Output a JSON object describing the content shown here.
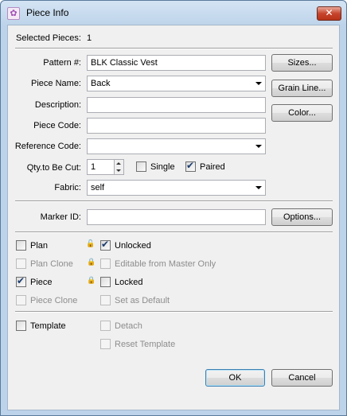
{
  "window": {
    "title": "Piece Info"
  },
  "selected": {
    "label": "Selected Pieces:",
    "value": "1"
  },
  "fields": {
    "pattern": {
      "label": "Pattern #:",
      "value": "BLK Classic Vest"
    },
    "piece_name": {
      "label": "Piece Name:",
      "value": "Back"
    },
    "description": {
      "label": "Description:",
      "value": ""
    },
    "piece_code": {
      "label": "Piece Code:",
      "value": ""
    },
    "reference_code": {
      "label": "Reference Code:",
      "value": ""
    },
    "qty": {
      "label": "Qty.to Be Cut:",
      "value": "1"
    },
    "fabric": {
      "label": "Fabric:",
      "value": "self"
    },
    "marker_id": {
      "label": "Marker ID:",
      "value": ""
    }
  },
  "side_buttons": {
    "sizes": "Sizes...",
    "grain_line": "Grain Line...",
    "color": "Color...",
    "options": "Options..."
  },
  "qty_options": {
    "single": {
      "label": "Single",
      "checked": false
    },
    "paired": {
      "label": "Paired",
      "checked": true
    }
  },
  "checkboxes": {
    "plan": {
      "label": "Plan",
      "checked": false,
      "enabled": true
    },
    "unlocked": {
      "label": "Unlocked",
      "checked": true,
      "enabled": true
    },
    "plan_clone": {
      "label": "Plan Clone",
      "checked": false,
      "enabled": false
    },
    "editable_master": {
      "label": "Editable from Master Only",
      "checked": false,
      "enabled": false
    },
    "piece": {
      "label": "Piece",
      "checked": true,
      "enabled": true
    },
    "locked": {
      "label": "Locked",
      "checked": false,
      "enabled": true
    },
    "piece_clone": {
      "label": "Piece Clone",
      "checked": false,
      "enabled": false
    },
    "set_default": {
      "label": "Set as Default",
      "checked": false,
      "enabled": false
    },
    "template": {
      "label": "Template",
      "checked": false,
      "enabled": true
    },
    "detach": {
      "label": "Detach",
      "checked": false,
      "enabled": false
    },
    "reset_template": {
      "label": "Reset Template",
      "checked": false,
      "enabled": false
    }
  },
  "footer": {
    "ok": "OK",
    "cancel": "Cancel"
  },
  "icons": {
    "close": "close-icon",
    "app": "app-icon",
    "lock_open": "lock-open-icon",
    "lock": "lock-icon"
  }
}
